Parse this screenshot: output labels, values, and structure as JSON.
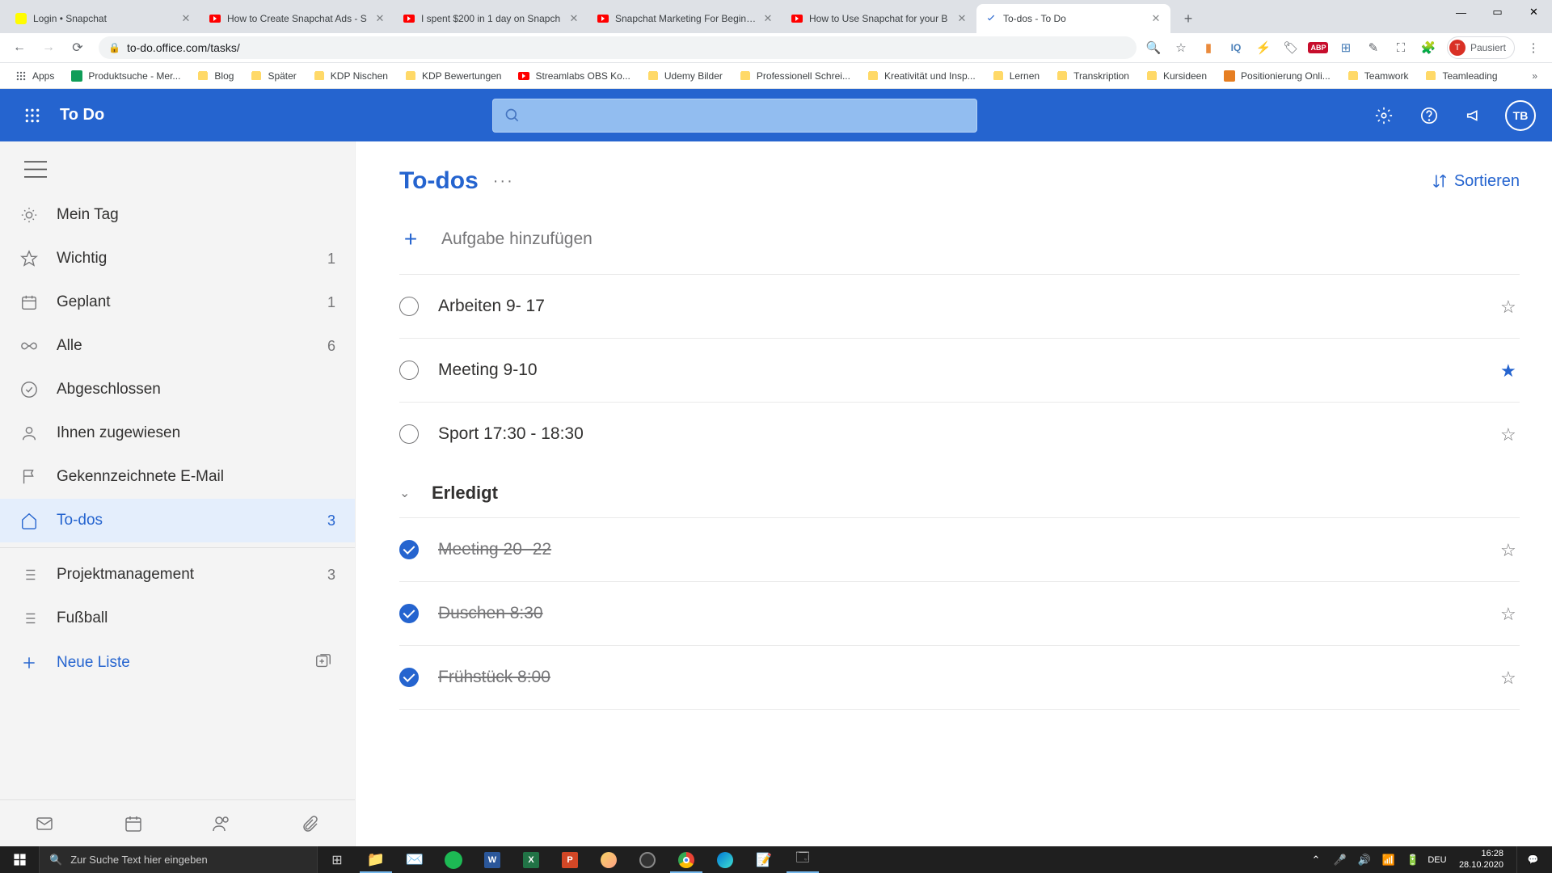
{
  "browser": {
    "tabs": [
      {
        "label": "Login • Snapchat",
        "favicon": "snap"
      },
      {
        "label": "How to Create Snapchat Ads - S",
        "favicon": "yt"
      },
      {
        "label": "I spent $200 in 1 day on Snapch",
        "favicon": "yt"
      },
      {
        "label": "Snapchat Marketing For Beginne",
        "favicon": "yt"
      },
      {
        "label": "How to Use Snapchat for your B",
        "favicon": "yt"
      },
      {
        "label": "To-dos - To Do",
        "favicon": "todo",
        "active": true
      }
    ],
    "url": "to-do.office.com/tasks/",
    "profile_label": "Pausiert",
    "profile_initial": "T",
    "bookmarks": [
      {
        "label": "Apps",
        "icon": "grid"
      },
      {
        "label": "Produktsuche - Mer...",
        "icon": "green"
      },
      {
        "label": "Blog",
        "icon": "folder"
      },
      {
        "label": "Später",
        "icon": "folder"
      },
      {
        "label": "KDP Nischen",
        "icon": "folder"
      },
      {
        "label": "KDP Bewertungen",
        "icon": "folder"
      },
      {
        "label": "Streamlabs OBS Ko...",
        "icon": "yt"
      },
      {
        "label": "Udemy Bilder",
        "icon": "folder"
      },
      {
        "label": "Professionell Schrei...",
        "icon": "folder"
      },
      {
        "label": "Kreativität und Insp...",
        "icon": "folder"
      },
      {
        "label": "Lernen",
        "icon": "folder"
      },
      {
        "label": "Transkription",
        "icon": "folder"
      },
      {
        "label": "Kursideen",
        "icon": "folder"
      },
      {
        "label": "Positionierung Onli...",
        "icon": "pos"
      },
      {
        "label": "Teamwork",
        "icon": "folder"
      },
      {
        "label": "Teamleading",
        "icon": "folder"
      }
    ]
  },
  "app": {
    "brand": "To Do",
    "avatar": "TB",
    "sidebar": {
      "items": [
        {
          "icon": "sun",
          "label": "Mein Tag"
        },
        {
          "icon": "star",
          "label": "Wichtig",
          "count": "1"
        },
        {
          "icon": "calendar",
          "label": "Geplant",
          "count": "1"
        },
        {
          "icon": "infinity",
          "label": "Alle",
          "count": "6"
        },
        {
          "icon": "check",
          "label": "Abgeschlossen"
        },
        {
          "icon": "person",
          "label": "Ihnen zugewiesen"
        },
        {
          "icon": "flag",
          "label": "Gekennzeichnete E-Mail"
        },
        {
          "icon": "home",
          "label": "To-dos",
          "count": "3",
          "active": true
        }
      ],
      "custom_lists": [
        {
          "label": "Projektmanagement",
          "count": "3"
        },
        {
          "label": "Fußball"
        }
      ],
      "new_list_label": "Neue Liste"
    },
    "main": {
      "title": "To-dos",
      "sort_label": "Sortieren",
      "add_placeholder": "Aufgabe hinzufügen",
      "tasks": [
        {
          "title": "Arbeiten 9- 17",
          "done": false,
          "starred": false
        },
        {
          "title": "Meeting 9-10",
          "done": false,
          "starred": true
        },
        {
          "title": "Sport 17:30 - 18:30",
          "done": false,
          "starred": false
        }
      ],
      "completed_section": "Erledigt",
      "completed_tasks": [
        {
          "title": "Meeting 20- 22"
        },
        {
          "title": "Duschen 8:30"
        },
        {
          "title": "Frühstück 8:00"
        }
      ]
    }
  },
  "taskbar": {
    "search_placeholder": "Zur Suche Text hier eingeben",
    "lang": "DEU",
    "time": "16:28",
    "date": "28.10.2020"
  }
}
